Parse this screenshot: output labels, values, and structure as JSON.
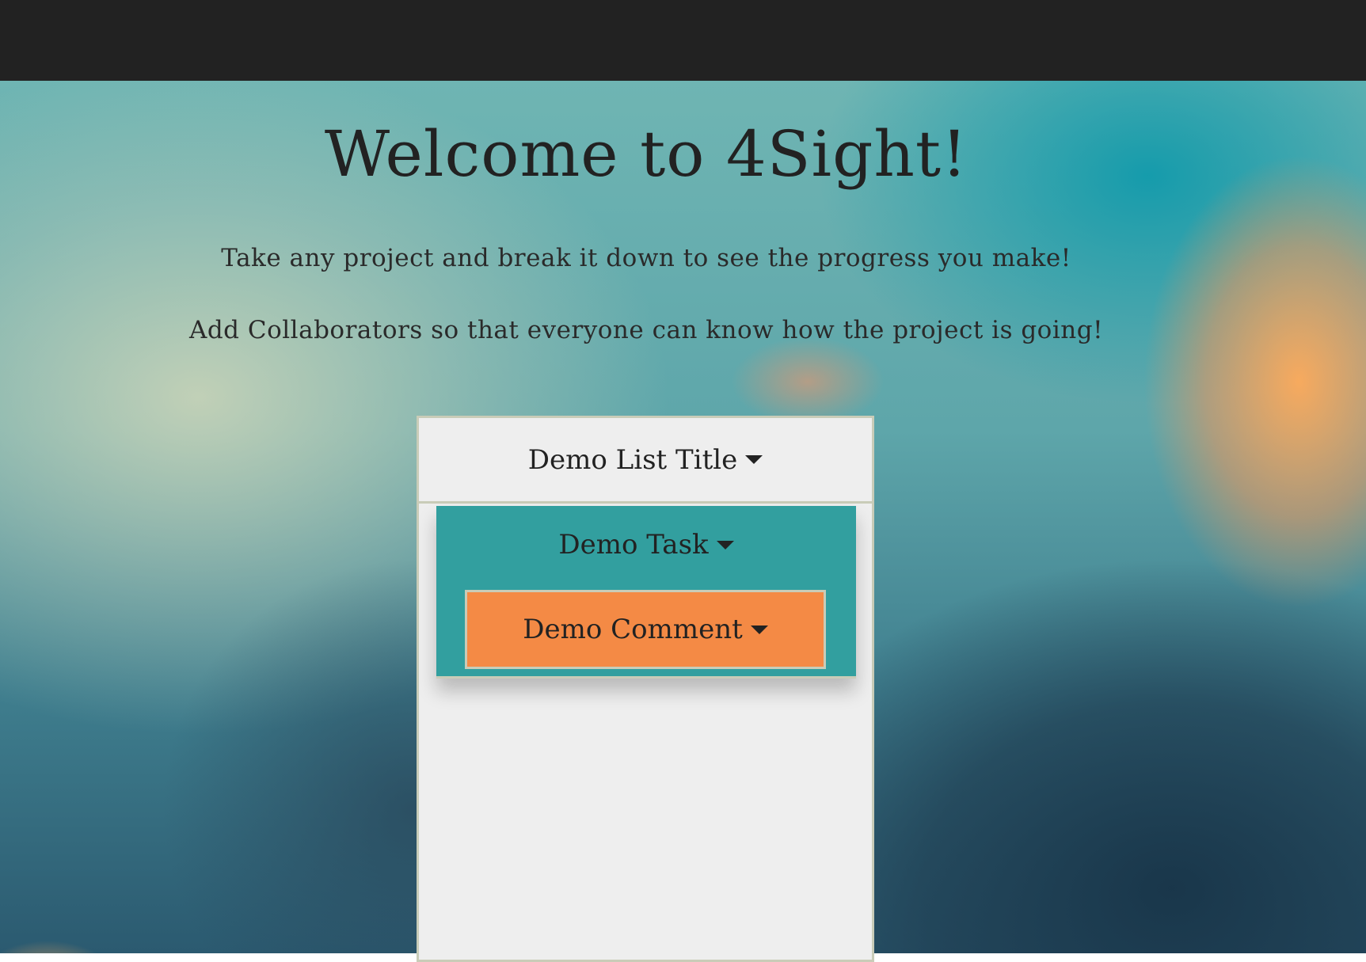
{
  "page": {
    "title": "Welcome to 4Sight!",
    "subtitle_1": "Take any project and break it down to see the progress you make!",
    "subtitle_2": "Add Collaborators so that everyone can know how the project is going!"
  },
  "demo": {
    "list_title": "Demo List Title",
    "task_title": "Demo Task",
    "comment_title": "Demo Comment"
  },
  "colors": {
    "topbar": "#222222",
    "list_background": "#eeeeee",
    "task_background": "#329f9f",
    "comment_background": "#f48a45",
    "border": "#c9ccb8"
  },
  "icons": {
    "dropdown": "caret-down-icon"
  }
}
